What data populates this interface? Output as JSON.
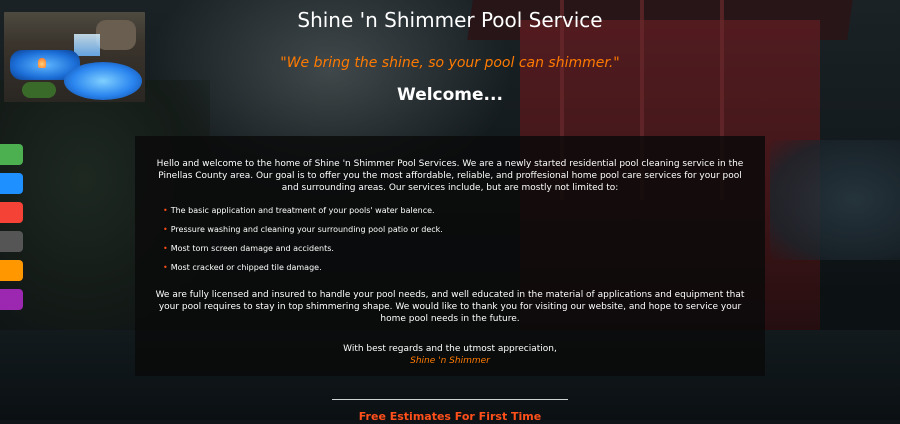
{
  "header": {
    "site_title": "Shine 'n Shimmer Pool Service",
    "tagline": "\"We bring the shine, so your pool can shimmer.\"",
    "welcome": "Welcome..."
  },
  "color_tabs": [
    {
      "color": "#4caf50"
    },
    {
      "color": "#1e90ff"
    },
    {
      "color": "#f44336"
    },
    {
      "color": "#555555"
    },
    {
      "color": "#ff9800"
    },
    {
      "color": "#9c27b0"
    }
  ],
  "content": {
    "intro": "Hello and welcome to the home of Shine 'n Shimmer Pool Services. We are a newly started residential pool cleaning service in the Pinellas County area. Our goal is to offer you the most affordable, reliable, and proffesional home pool care services for your pool and surrounding areas. Our services include, but are mostly not limited to:",
    "services": [
      {
        "bullet": "•",
        "text": "The basic application and treatment of your pools' water balence."
      },
      {
        "bullet": "•",
        "text": "Pressure washing and cleaning your surrounding pool patio or deck."
      },
      {
        "bullet": "•",
        "text": "Most torn screen damage and accidents."
      },
      {
        "bullet": "•",
        "text": "Most cracked or chipped tile damage."
      }
    ],
    "closing": "We are fully licensed and insured to handle your pool needs, and well educated in the material of applications and equipment that your pool requires to stay in top shimmering shape. We would like to thank you for visiting our website, and hope to service your home pool needs in the future.",
    "regards": "With best regards and the utmost appreciation,",
    "signature": "Shine 'n Shimmer"
  },
  "footer": {
    "free_estimates": "Free Estimates For First Time"
  },
  "colors": {
    "accent_orange": "#ff7a00",
    "bullet_red": "#ff4f1a",
    "panel_bg": "rgba(10,10,10,0.82)"
  }
}
